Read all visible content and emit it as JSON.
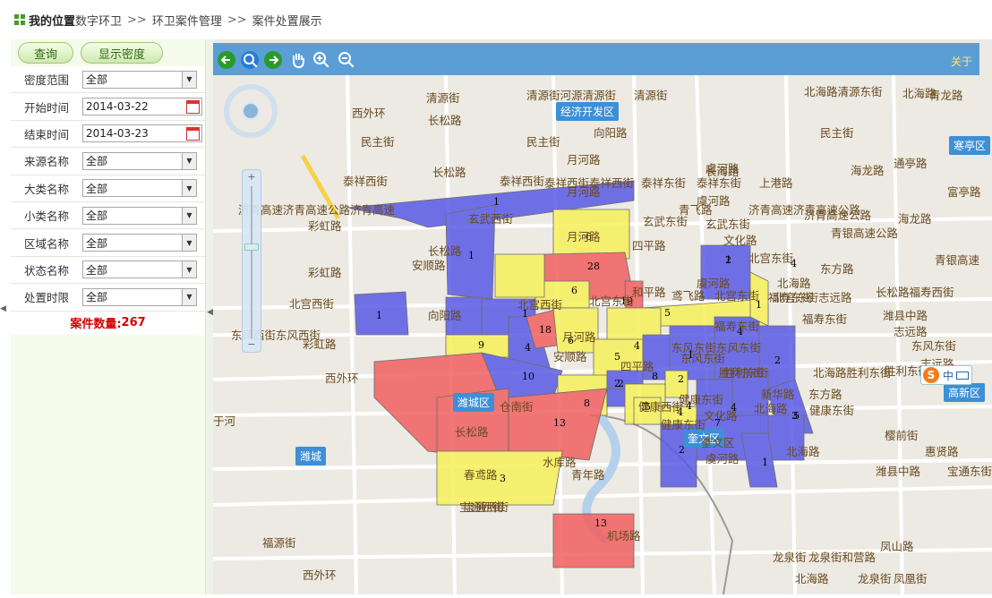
{
  "breadcrumb": {
    "location_label": "我的位置",
    "items": [
      "数字环卫",
      "环卫案件管理",
      "案件处置展示"
    ],
    "separator": ">>"
  },
  "left_panel": {
    "query_button": "查询",
    "density_button": "显示密度",
    "filters": [
      {
        "label": "密度范围",
        "value": "全部"
      },
      {
        "label": "开始时间",
        "value": "2014-03-22",
        "type": "date"
      },
      {
        "label": "结束时间",
        "value": "2014-03-23",
        "type": "date"
      },
      {
        "label": "来源名称",
        "value": "全部"
      },
      {
        "label": "大类名称",
        "value": "全部"
      },
      {
        "label": "小类名称",
        "value": "全部"
      },
      {
        "label": "区域名称",
        "value": "全部"
      },
      {
        "label": "状态名称",
        "value": "全部"
      },
      {
        "label": "处置时限",
        "value": "全部"
      }
    ],
    "case_count_label": "案件数量:",
    "case_count": "267"
  },
  "map": {
    "about_label": "关于",
    "districts": [
      "经济开发区",
      "潍城区",
      "奎文区",
      "潍城",
      "寒亭区",
      "高新区"
    ],
    "street_labels": [
      "清源街",
      "清源街河源清源街",
      "清源街",
      "西外环",
      "长松路",
      "民主街",
      "民主街",
      "向阳路",
      "北海路清源东街",
      "北海路",
      "青龙路",
      "民主街",
      "月河路",
      "泰祥西街",
      "泰祥西街泰祥西街",
      "长松路",
      "泰祥西街",
      "泰祥东街",
      "虞河路",
      "泰祥东街",
      "上港路",
      "海龙路",
      "通亭路",
      "月河路",
      "虞河路",
      "长海路",
      "富亭路",
      "玄武西街",
      "青飞路",
      "济青高速济青高速公路",
      "济青高速公路",
      "海龙路",
      "济青高速济青高速公路济青高速",
      "玄武东街",
      "玄武东街",
      "青银高速公路",
      "彩虹路",
      "月河路",
      "四平路",
      "文化路",
      "北宫东街",
      "长松路",
      "安顺路",
      "东方路",
      "青银高速",
      "彩虹路",
      "虞河路",
      "北海路",
      "北宫西街",
      "和平路",
      "鸢飞路",
      "北宫东街",
      "北宫东街志远路",
      "长松路福寿西街",
      "向阳路",
      "北宫东街",
      "福寿东街",
      "北宫西街",
      "福寿东街",
      "潍县中路",
      "福寿东街",
      "志远路",
      "东风西街东风西街",
      "月河路",
      "东风东街东风东街",
      "东风东街",
      "志远路",
      "彩虹路",
      "安顺路",
      "东风东街",
      "胜利东街",
      "北海路胜利东街",
      "胜利东街",
      "西外环",
      "四平路",
      "胜利东街",
      "新华路",
      "东方路",
      "健康东街",
      "健康东街",
      "北海路",
      "健康西街",
      "文化路",
      "仓南街",
      "健康东街",
      "樱前街",
      "长松路",
      "虞河路",
      "北海路",
      "于河",
      "奎文区",
      "惠贤路",
      "潍县中路",
      "宝通东街",
      "春鸢路",
      "水库路",
      "青年路",
      "宝通西街",
      "宝通西街",
      "福源街",
      "西外环",
      "机场路",
      "龙泉街",
      "龙泉街和营路",
      "凤山路",
      "北海路",
      "龙泉街",
      "凤凰街"
    ],
    "case_region_counts": [
      "1",
      "1",
      "6",
      "28",
      "6",
      "1",
      "19",
      "5",
      "2",
      "4",
      "1",
      "1",
      "9",
      "4",
      "18",
      "6",
      "4",
      "5",
      "8",
      "3",
      "10",
      "1",
      "4",
      "2",
      "1",
      "2",
      "4",
      "4",
      "5",
      "8",
      "2",
      "2",
      "5",
      "3",
      "10",
      "13",
      "7",
      "4",
      "5",
      "2",
      "1",
      "13",
      "3"
    ]
  },
  "colors": {
    "toolbar": "#5b9ed6",
    "blue_region": "#5a5ae6",
    "yellow_region": "#f6f05a",
    "red_region": "#f06060",
    "count_text": "#d40000"
  }
}
